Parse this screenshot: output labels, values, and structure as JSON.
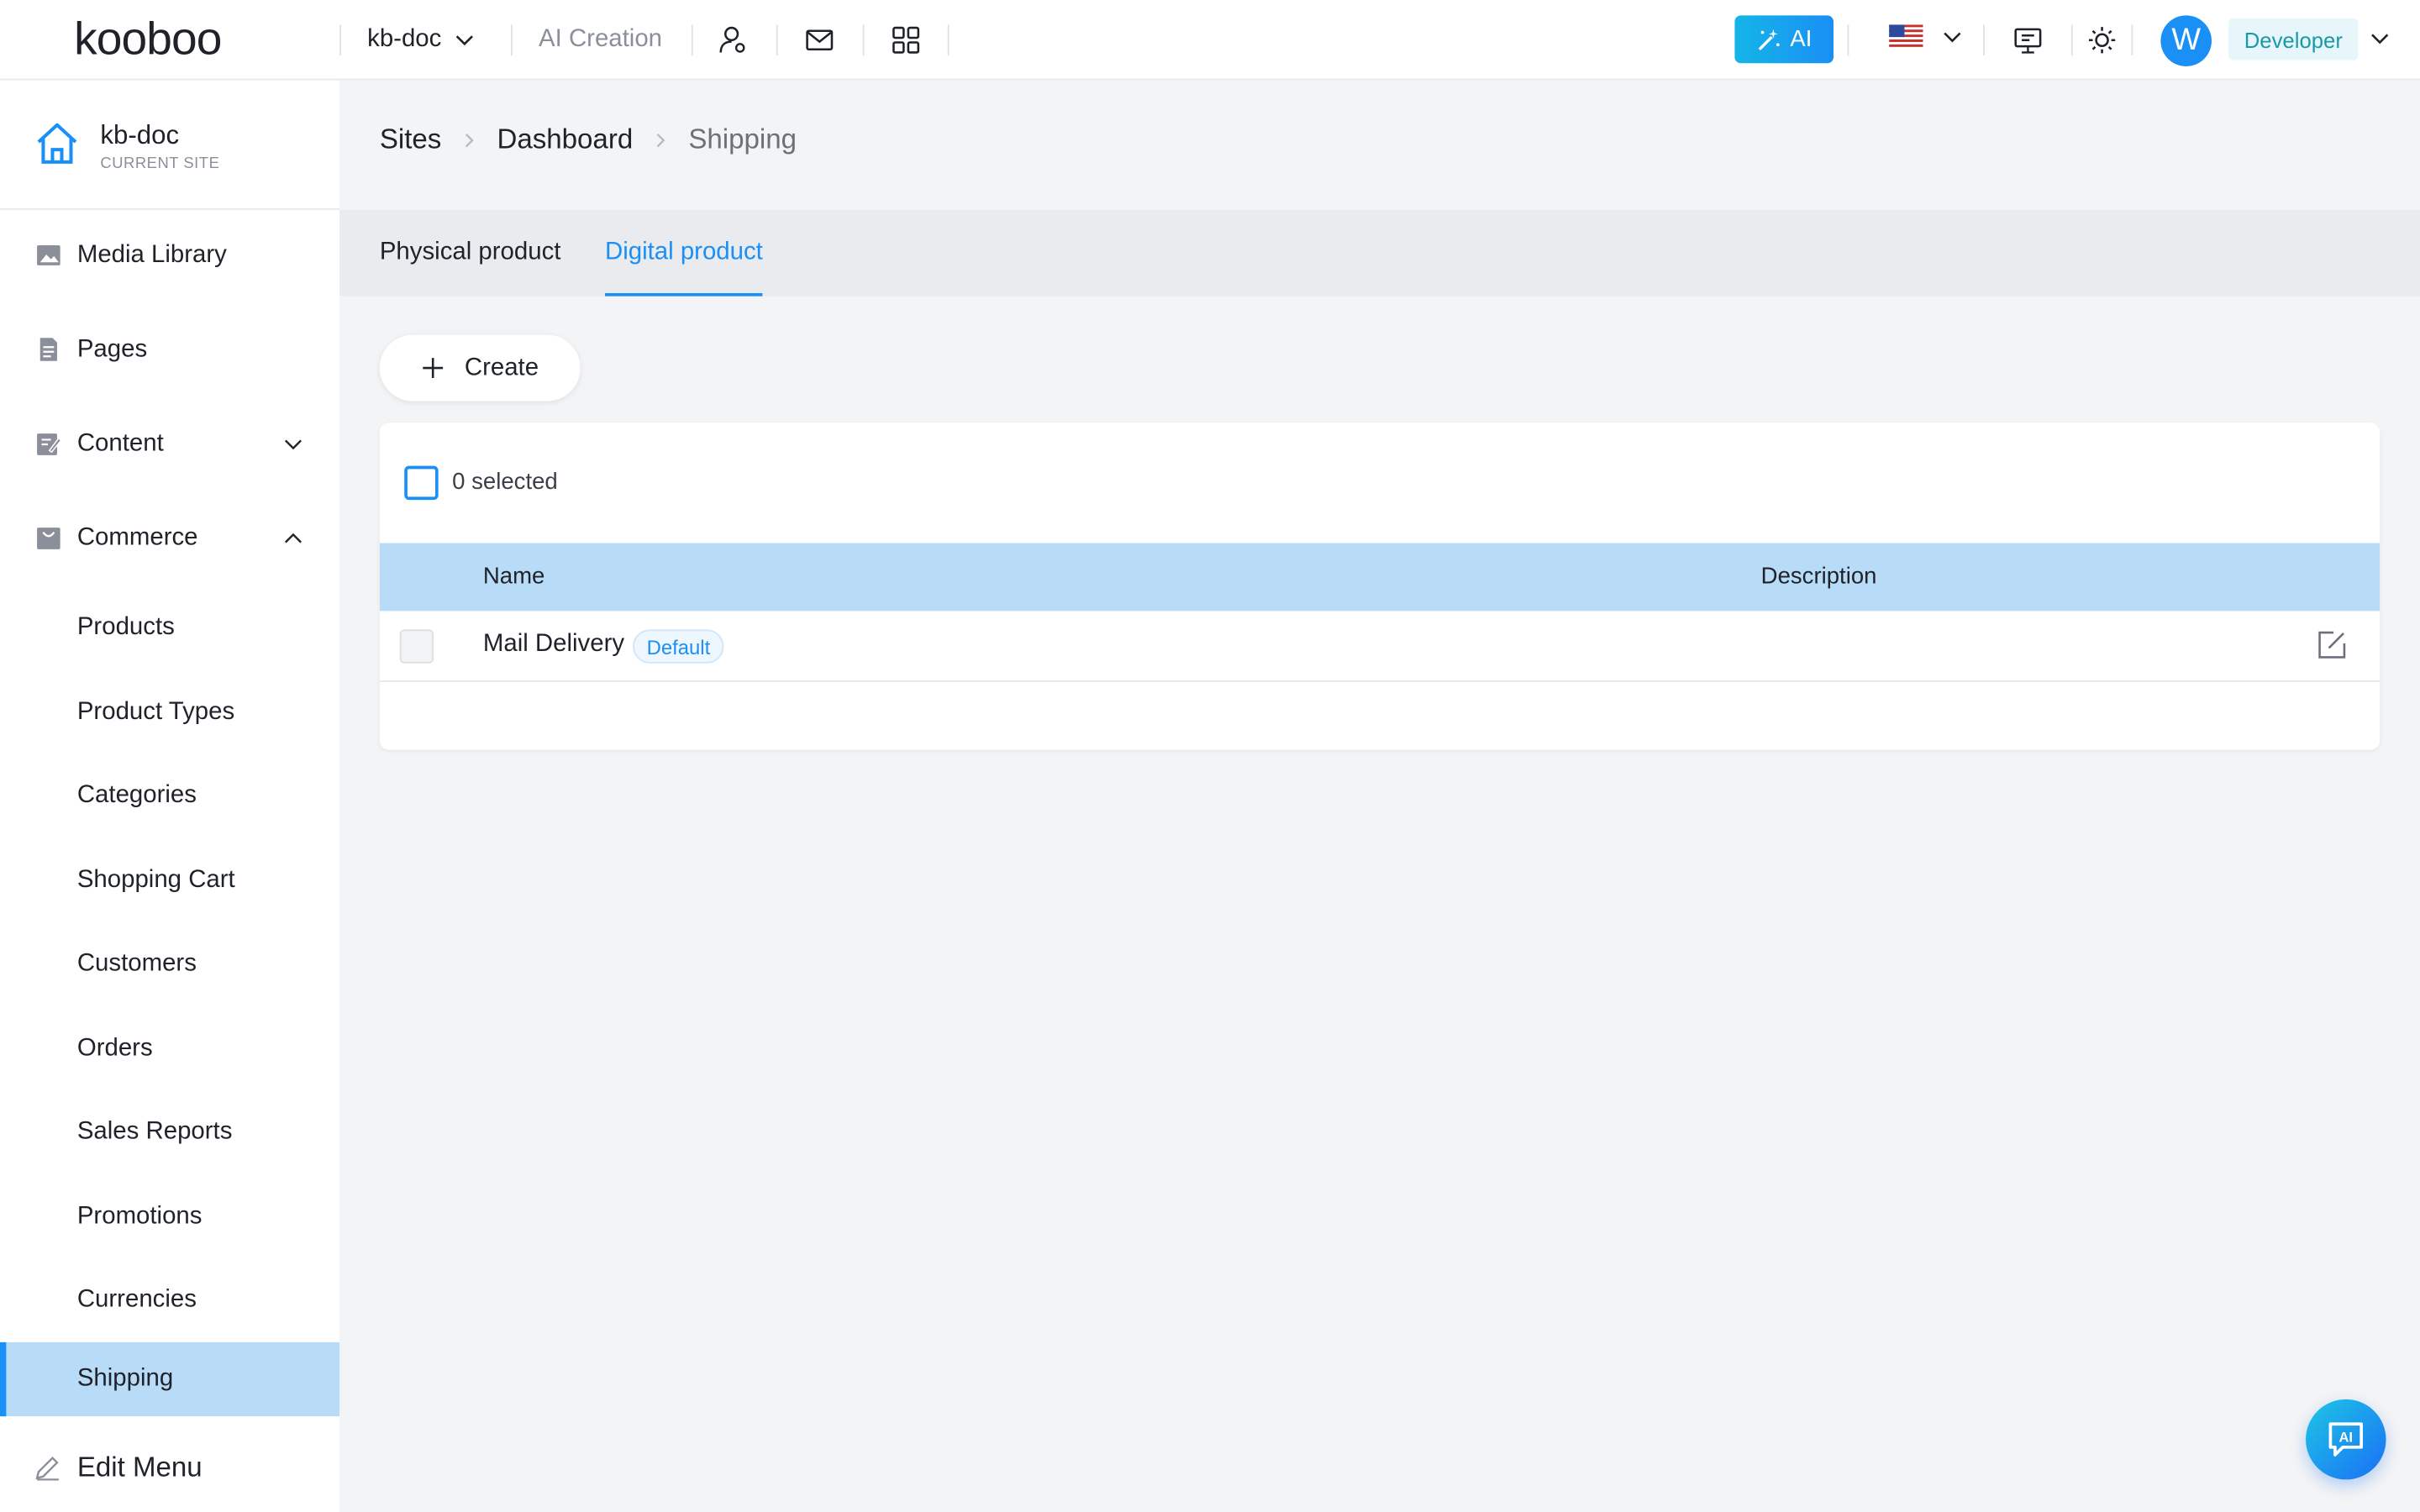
{
  "header": {
    "logo": "kooboo",
    "site_name": "kb-doc",
    "ai_creation": "AI Creation",
    "ai_button": "AI",
    "avatar_initial": "W",
    "role": "Developer"
  },
  "sidebar": {
    "current_site": {
      "name": "kb-doc",
      "label": "CURRENT SITE"
    },
    "items": [
      {
        "label": "Media Library",
        "icon": "image-icon"
      },
      {
        "label": "Pages",
        "icon": "document-icon"
      },
      {
        "label": "Content",
        "icon": "content-icon",
        "expanded": false
      },
      {
        "label": "Commerce",
        "icon": "shop-icon",
        "expanded": true
      }
    ],
    "commerce_items": [
      {
        "label": "Products"
      },
      {
        "label": "Product Types"
      },
      {
        "label": "Categories"
      },
      {
        "label": "Shopping Cart"
      },
      {
        "label": "Customers"
      },
      {
        "label": "Orders"
      },
      {
        "label": "Sales Reports"
      },
      {
        "label": "Promotions"
      },
      {
        "label": "Currencies"
      },
      {
        "label": "Shipping",
        "active": true
      }
    ],
    "edit_menu": "Edit Menu"
  },
  "breadcrumb": [
    "Sites",
    "Dashboard",
    "Shipping"
  ],
  "tabs": [
    {
      "label": "Physical product",
      "active": false
    },
    {
      "label": "Digital product",
      "active": true
    }
  ],
  "toolbar": {
    "create_label": "Create"
  },
  "table": {
    "selected_text": "0 selected",
    "columns": [
      "Name",
      "Description"
    ],
    "rows": [
      {
        "name": "Mail Delivery",
        "badge": "Default",
        "description": ""
      }
    ]
  },
  "colors": {
    "accent": "#1a8ff5",
    "active_bg": "#b8dbf7",
    "role_text": "#1a9aa6"
  },
  "fab": {
    "label": "AI"
  }
}
